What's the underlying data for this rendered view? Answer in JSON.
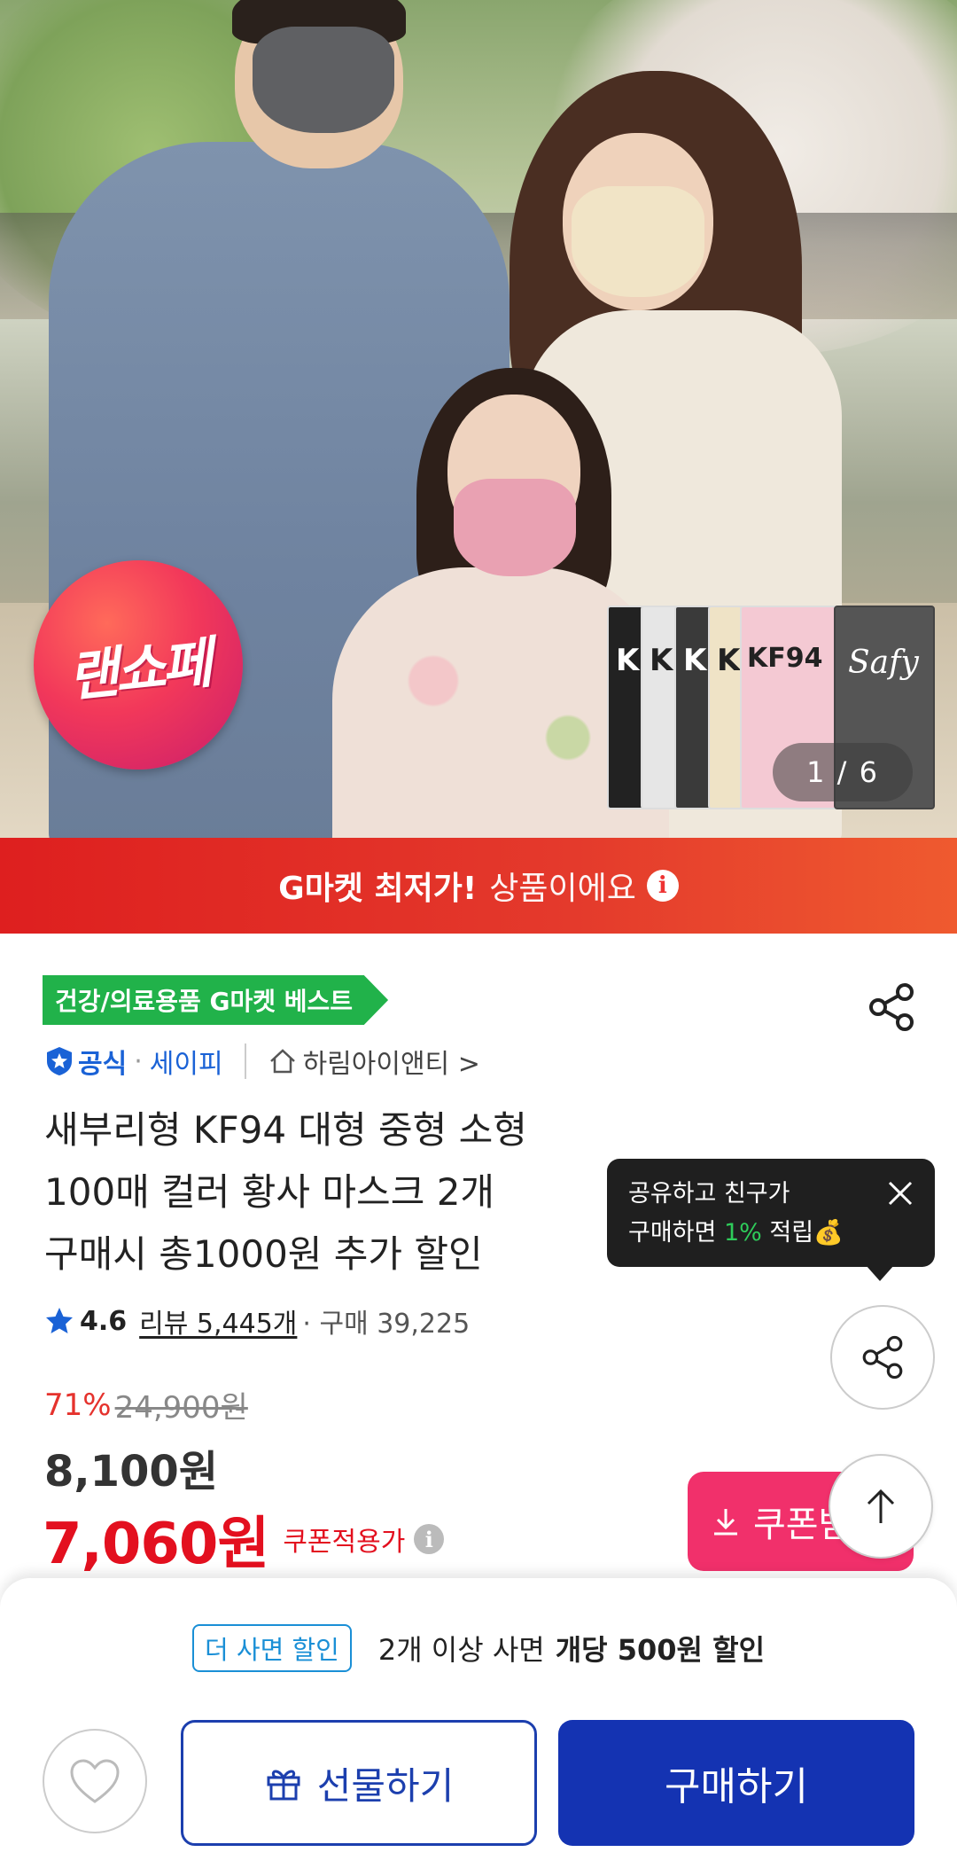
{
  "hero": {
    "badge_text": "랜쇼페",
    "pack_labels": [
      "KI",
      "KI",
      "KI",
      "KI",
      "KF94",
      "Safy"
    ],
    "image_counter": "1 / 6"
  },
  "banner": {
    "strong": "G마켓 최저가!",
    "normal": "상품이에요",
    "info_icon": "info-icon"
  },
  "product": {
    "category_tag": "건강/의료용품 G마켓 베스트",
    "official_label": "공식",
    "brand": "세이피",
    "store": "하림아이앤티 >",
    "title_lines": [
      "새부리형 KF94 대형 중형 소형",
      "100매 컬러 황사 마스크 2개",
      "구매시 총1000원 추가 할인"
    ],
    "rating": "4.6",
    "reviews": "리뷰 5,445개",
    "purchases": "· 구매 39,225",
    "discount_rate": "71%",
    "original_price": "24,900원",
    "price": "8,100원",
    "coupon_price": "7,060원",
    "coupon_label": "쿠폰적용가",
    "coupon_button": "쿠폰받"
  },
  "tooltip": {
    "line1": "공유하고 친구가",
    "line2_prefix": "구매하면 ",
    "line2_highlight": "1%",
    "line2_suffix": " 적립💰"
  },
  "bottom": {
    "deal_tag": "더 사면 할인",
    "deal_text": "2개 이상 사면",
    "deal_strong": "개당 500원 할인",
    "gift_label": "선물하기",
    "buy_label": "구매하기"
  },
  "colors": {
    "banner_red": "#de1f1f",
    "category_green": "#21b24a",
    "price_red": "#e3101f",
    "coupon_pink": "#f1306b",
    "buy_blue": "#1433b2",
    "official_blue": "#1a62d6"
  }
}
